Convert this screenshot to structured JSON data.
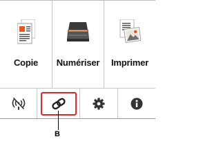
{
  "menu": {
    "items": [
      {
        "label": "Copie",
        "icon": "copy-document-icon"
      },
      {
        "label": "Numériser",
        "icon": "scanner-icon"
      },
      {
        "label": "Imprimer",
        "icon": "print-photo-icon"
      }
    ]
  },
  "toolbar": {
    "buttons": [
      {
        "icon": "wireless-off-icon"
      },
      {
        "icon": "link-chain-icon",
        "highlighted": true
      },
      {
        "icon": "gear-icon"
      },
      {
        "icon": "info-icon"
      }
    ]
  },
  "callout": {
    "label": "B"
  },
  "colors": {
    "highlight": "#e02a2a",
    "accent": "#e8531f",
    "icon_dark": "#333333"
  }
}
